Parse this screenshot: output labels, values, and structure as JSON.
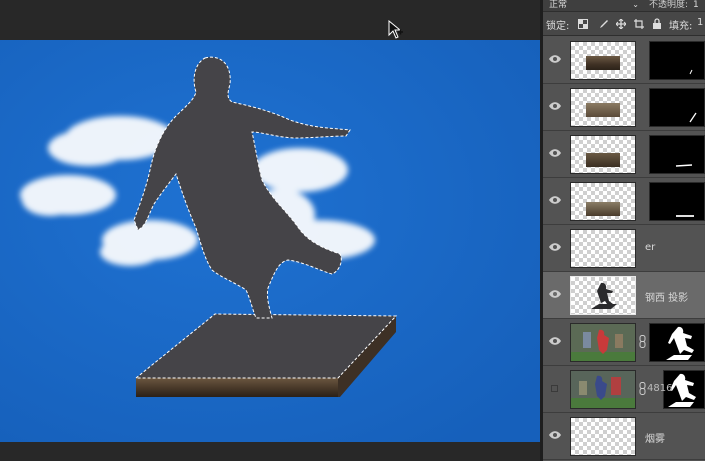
{
  "layers_panel": {
    "blend_mode": "正常",
    "opacity_label": "不透明度:",
    "opacity_value": "1",
    "lock_label": "锁定:",
    "lock_icons": [
      "lock-transparent-pixels-icon",
      "lock-image-pixels-icon",
      "lock-position-icon",
      "lock-artboard-icon",
      "lock-all-icon"
    ],
    "fill_label": "填充:",
    "fill_value": "1",
    "layers": [
      {
        "name": "",
        "visible": true,
        "thumb": "soil",
        "has_mask": true
      },
      {
        "name": "",
        "visible": true,
        "thumb": "soil",
        "has_mask": true
      },
      {
        "name": "",
        "visible": true,
        "thumb": "soil",
        "has_mask": true
      },
      {
        "name": "",
        "visible": true,
        "thumb": "soil",
        "has_mask": true
      },
      {
        "name": "er",
        "visible": true,
        "thumb": "empty",
        "has_mask": false
      },
      {
        "name": "钢西 投影",
        "visible": true,
        "thumb": "shadow",
        "has_mask": false,
        "selected": true
      },
      {
        "name": "",
        "visible": true,
        "thumb": "player",
        "has_mask": true
      },
      {
        "name": "4816",
        "visible": false,
        "thumb": "player",
        "has_mask": true
      },
      {
        "name": "烟雾",
        "visible": true,
        "thumb": "empty",
        "has_mask": false
      }
    ]
  },
  "colors": {
    "canvas_bg": "#1b68c7",
    "panel_bg": "#535353",
    "selected_layer": "#6a6a6a",
    "silhouette": "#454448"
  },
  "icons": {
    "cursor": "arrow-cursor-icon",
    "visibility": "eye-icon",
    "link": "chain-link-icon"
  }
}
